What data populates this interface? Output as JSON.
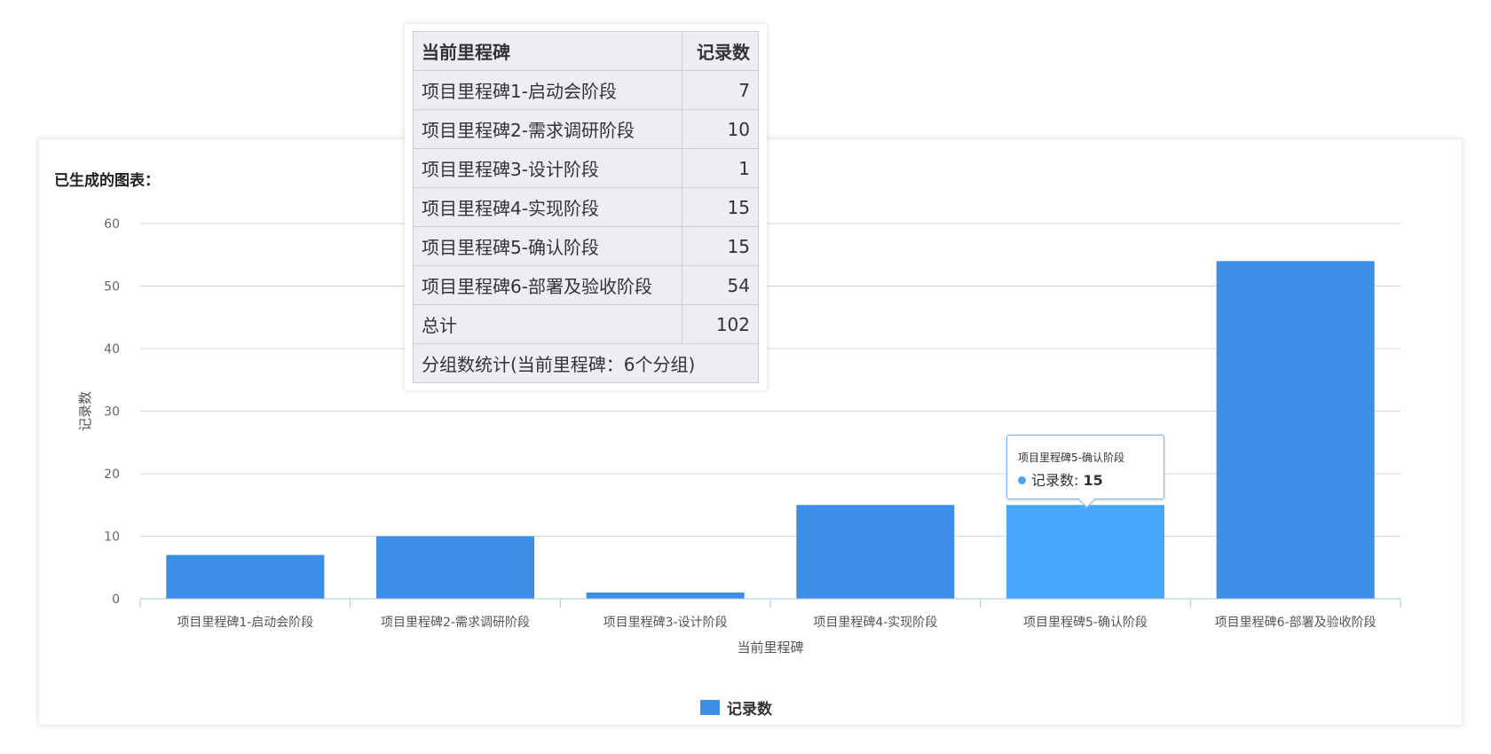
{
  "card": {
    "title": "已生成的图表："
  },
  "stats_table": {
    "header": [
      "当前里程碑",
      "记录数"
    ],
    "rows": [
      [
        "项目里程碑1-启动会阶段",
        "7"
      ],
      [
        "项目里程碑2-需求调研阶段",
        "10"
      ],
      [
        "项目里程碑3-设计阶段",
        "1"
      ],
      [
        "项目里程碑4-实现阶段",
        "15"
      ],
      [
        "项目里程碑5-确认阶段",
        "15"
      ],
      [
        "项目里程碑6-部署及验收阶段",
        "54"
      ]
    ],
    "total_label": "总计",
    "total_value": "102",
    "footer": "分组数统计(当前里程碑：6个分组)"
  },
  "tooltip": {
    "title": "项目里程碑5-确认阶段",
    "series_label": "记录数: ",
    "value": "15"
  },
  "colors": {
    "bar": "#3d8ee6",
    "bar_hover": "#4aa8fb",
    "grid": "#d9d9d9"
  },
  "chart_data": {
    "type": "bar",
    "categories": [
      "项目里程碑1-启动会阶段",
      "项目里程碑2-需求调研阶段",
      "项目里程碑3-设计阶段",
      "项目里程碑4-实现阶段",
      "项目里程碑5-确认阶段",
      "项目里程碑6-部署及验收阶段"
    ],
    "series": [
      {
        "name": "记录数",
        "values": [
          7,
          10,
          1,
          15,
          15,
          54
        ]
      }
    ],
    "xlabel": "当前里程碑",
    "ylabel": "记录数",
    "ylim": [
      0,
      60
    ],
    "yticks": [
      0,
      10,
      20,
      30,
      40,
      50,
      60
    ],
    "highlighted_index": 4,
    "grid": true,
    "legend": "bottom-center"
  }
}
